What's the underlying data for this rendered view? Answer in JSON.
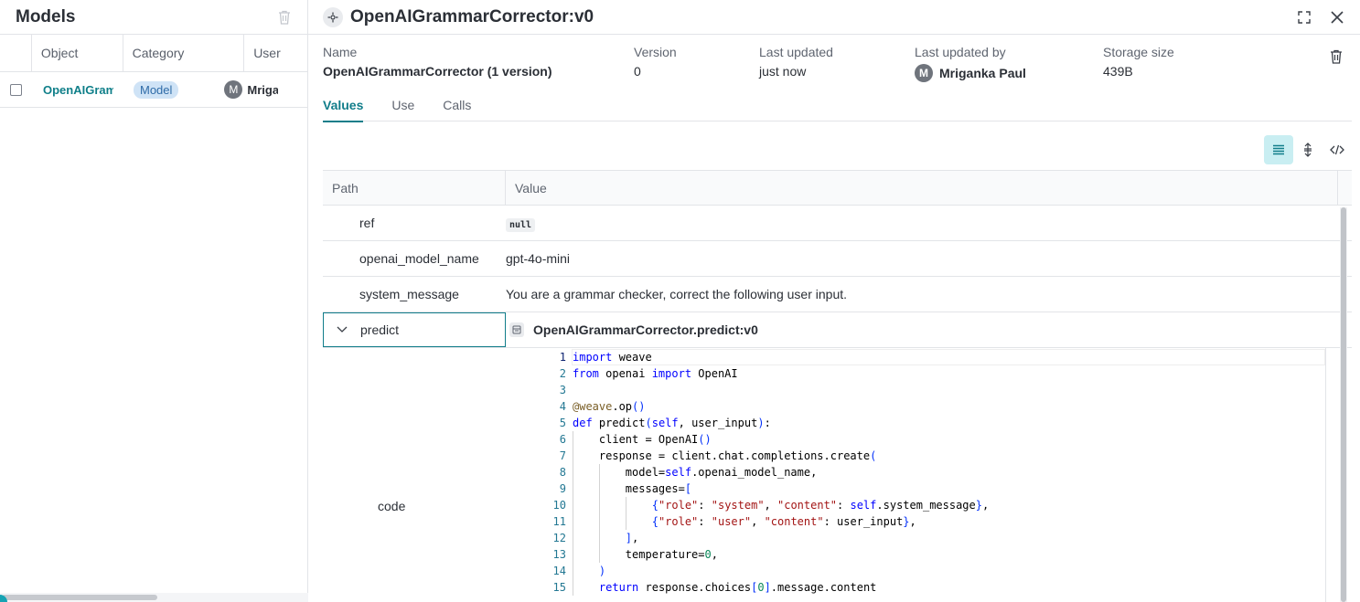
{
  "left": {
    "title": "Models",
    "columns": [
      "Object",
      "Category",
      "User"
    ],
    "rows": [
      {
        "object": "OpenAIGrammarCorrector",
        "category": "Model",
        "user_initial": "M",
        "user": "Mriganka Paul"
      }
    ]
  },
  "detail": {
    "title": "OpenAIGrammarCorrector:v0",
    "meta": {
      "name_label": "Name",
      "name_value": "OpenAIGrammarCorrector",
      "name_suffix": "(1 version)",
      "version_label": "Version",
      "version_value": "0",
      "updated_label": "Last updated",
      "updated_value": "just now",
      "updated_by_label": "Last updated by",
      "updated_by_initial": "M",
      "updated_by_value": "Mriganka Paul",
      "size_label": "Storage size",
      "size_value": "439B"
    },
    "tabs": [
      "Values",
      "Use",
      "Calls"
    ],
    "table": {
      "path_header": "Path",
      "value_header": "Value",
      "rows": [
        {
          "path": "ref",
          "value": "null"
        },
        {
          "path": "openai_model_name",
          "value": "gpt-4o-mini"
        },
        {
          "path": "system_message",
          "value": "You are a grammar checker, correct the following user input."
        }
      ],
      "predict_path": "predict",
      "predict_value": "OpenAIGrammarCorrector.predict:v0",
      "code_label": "code"
    },
    "code_lines": [
      "import weave",
      "from openai import OpenAI",
      "",
      "@weave.op()",
      "def predict(self, user_input):",
      "    client = OpenAI()",
      "    response = client.chat.completions.create(",
      "        model=self.openai_model_name,",
      "        messages=[",
      "            {\"role\": \"system\", \"content\": self.system_message},",
      "            {\"role\": \"user\", \"content\": user_input},",
      "        ],",
      "        temperature=0,",
      "    )",
      "    return response.choices[0].message.content"
    ]
  },
  "icons": {
    "trash": "trash-icon",
    "object": "object-icon",
    "expand": "expand-icon",
    "close": "close-icon",
    "list_view": "list-view-icon",
    "expand_rows": "expand-rows-icon",
    "code_view": "code-view-icon",
    "chevron": "chevron-down-icon",
    "op": "op-icon"
  },
  "colors": {
    "accent": "#117d8a",
    "link": "#0f7f89",
    "badge_bg": "#cfe3f6",
    "badge_fg": "#2f6ca8"
  }
}
